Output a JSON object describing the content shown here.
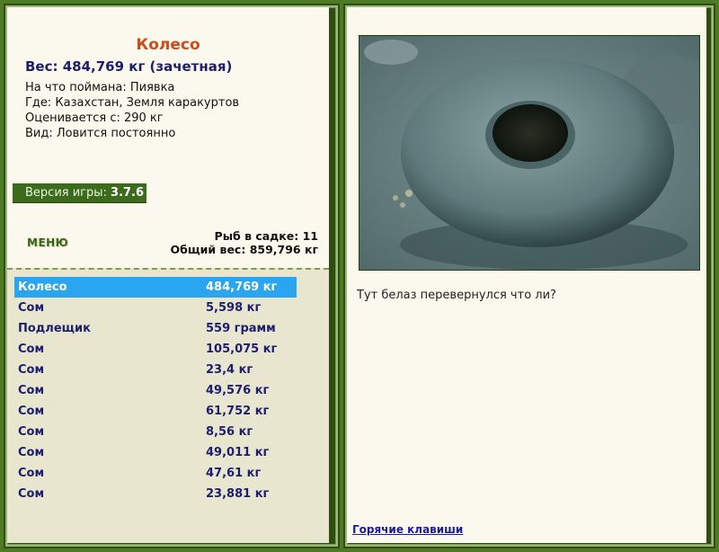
{
  "fish": {
    "name": "Колесо",
    "weight_line": "Вес: 484,769 кг (зачетная)",
    "caught_on": "На что поймана: Пиявка",
    "location": "Где: Казахстан, Земля каракуртов",
    "value": "Оценивается с: 290 кг",
    "kind": "Вид: Ловится постоянно"
  },
  "version": {
    "label": "Версия игры: ",
    "number": "3.7.6"
  },
  "menu_label": "МЕНЮ",
  "cage": {
    "count_line": "Рыб в садке: 11",
    "total_line": "Общий вес: 859,796 кг"
  },
  "catch_list": [
    {
      "name": "Колесо",
      "weight": "484,769 кг",
      "selected": true
    },
    {
      "name": "Сом",
      "weight": "5,598 кг"
    },
    {
      "name": "Подлещик",
      "weight": "559 грамм"
    },
    {
      "name": "Сом",
      "weight": "105,075 кг"
    },
    {
      "name": "Сом",
      "weight": "23,4 кг"
    },
    {
      "name": "Сом",
      "weight": "49,576 кг"
    },
    {
      "name": "Сом",
      "weight": "61,752 кг"
    },
    {
      "name": "Сом",
      "weight": "8,56 кг"
    },
    {
      "name": "Сом",
      "weight": "49,011 кг"
    },
    {
      "name": "Сом",
      "weight": "47,61 кг"
    },
    {
      "name": "Сом",
      "weight": "23,881 кг"
    }
  ],
  "photo_caption": "Тут белаз перевернулся что ли?",
  "hotkeys_label": "Горячие клавиши",
  "colors": {
    "background": "#4f7a24",
    "panel": "#fbf9ee",
    "list_bg": "#e9e6cf",
    "title": "#d24a1a",
    "text_blue": "#1c1f6e",
    "selected_row": "#2aa6f0"
  }
}
